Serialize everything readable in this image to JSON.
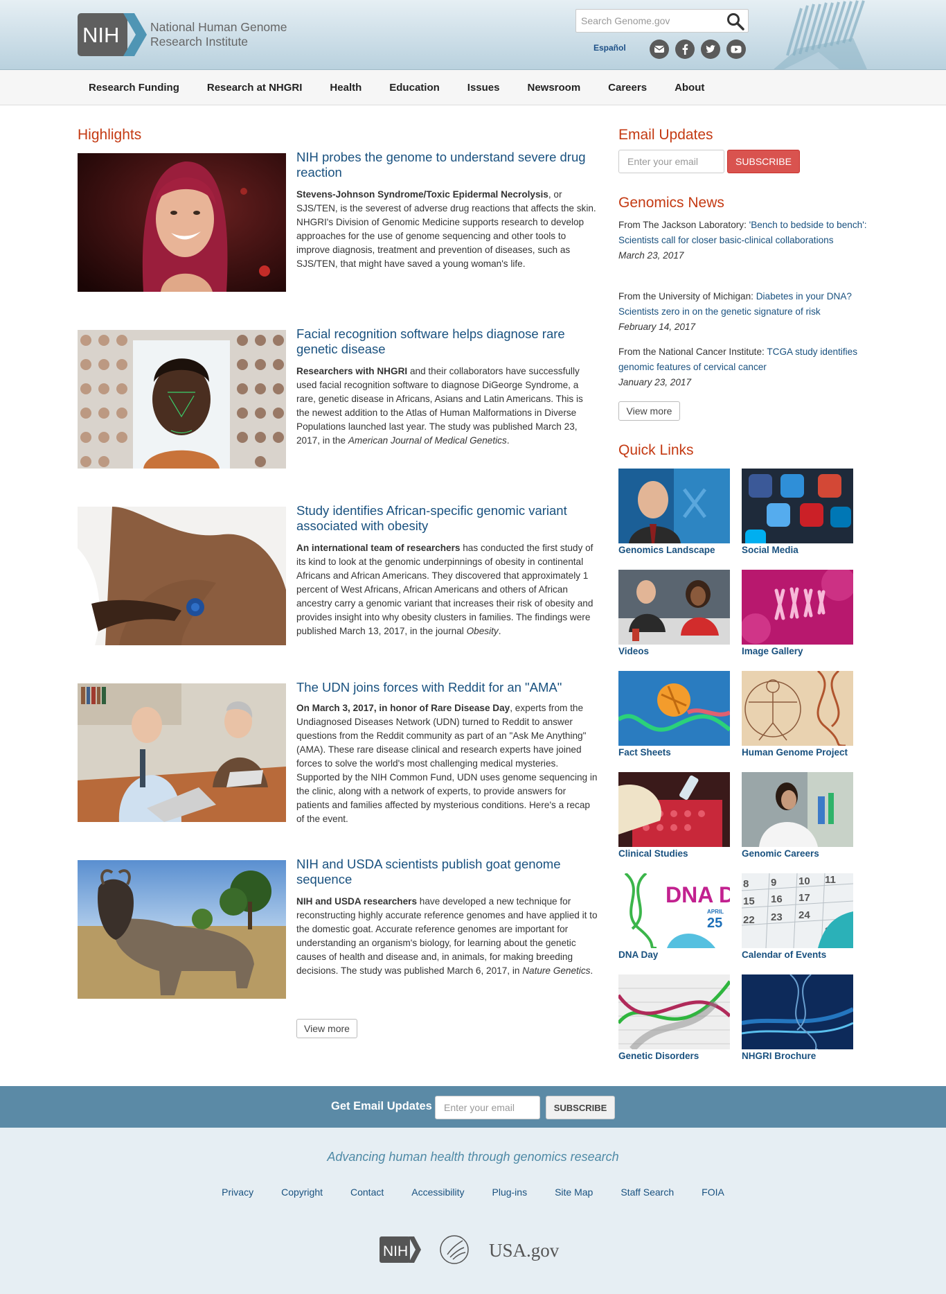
{
  "header": {
    "logo_text": "NIH",
    "org_name_line1": "National Human Genome",
    "org_name_line2": "Research Institute",
    "search_placeholder": "Search Genome.gov",
    "espanol": "Español",
    "social_icons": [
      "email-icon",
      "facebook-icon",
      "twitter-icon",
      "youtube-icon"
    ]
  },
  "nav": {
    "items": [
      "Research Funding",
      "Research at NHGRI",
      "Health",
      "Education",
      "Issues",
      "Newsroom",
      "Careers",
      "About"
    ]
  },
  "highlights": {
    "heading": "Highlights",
    "articles": [
      {
        "title": "NIH probes the genome to understand severe drug reaction",
        "lead": "Stevens-Johnson Syndrome/Toxic Epidermal Necrolysis",
        "body": ", or SJS/TEN, is the severest of adverse drug reactions that affects the skin. NHGRI's Division of Genomic Medicine supports research to develop approaches for the use of genome sequencing and other tools to improve diagnosis, treatment and prevention of diseases, such as SJS/TEN, that might have saved a young woman's life."
      },
      {
        "title": "Facial recognition software helps diagnose rare genetic disease",
        "lead": "Researchers with NHGRI",
        "body": " and their collaborators have successfully used facial recognition software to diagnose DiGeorge Syndrome, a rare, genetic disease in Africans, Asians and Latin Americans. This is the newest addition to the Atlas of Human Malformations in Diverse Populations launched last year. The study was published March 23, 2017, in the ",
        "journal": "American Journal of Medical Genetics",
        "tail": "."
      },
      {
        "title": "Study identifies African-specific genomic variant associated with obesity",
        "lead": "An international team of researchers",
        "body": " has conducted the first study of its kind to look at the genomic underpinnings of obesity in continental Africans and African Americans. They discovered that approximately 1 percent of West Africans, African Americans and others of African ancestry carry a genomic variant that increases their risk of obesity and provides insight into why obesity clusters in families. The findings were published March 13, 2017, in the journal ",
        "journal": "Obesity",
        "tail": "."
      },
      {
        "title": "The UDN joins forces with Reddit for an \"AMA\"",
        "lead": "On March 3, 2017, in honor of Rare Disease Day",
        "body": ", experts from the Undiagnosed Diseases Network (UDN) turned to Reddit to answer questions from the Reddit community as part of an \"Ask Me Anything\" (AMA). These rare disease clinical and research experts have joined forces to solve the world's most challenging medical mysteries. Supported by the NIH Common Fund, UDN uses genome sequencing in the clinic, along with a network of experts, to provide answers for patients and families affected by mysterious conditions. Here's a recap of the event."
      },
      {
        "title": "NIH and USDA scientists publish goat genome sequence",
        "lead": "NIH and USDA researchers",
        "body": " have developed a new technique for reconstructing highly accurate reference genomes and have applied it to the domestic goat. Accurate reference genomes are important for understanding an organism's biology, for learning about the genetic causes of health and disease and, in animals, for making breeding decisions. The study was published March 6, 2017, in ",
        "journal": "Nature Genetics",
        "tail": "."
      }
    ],
    "view_more": "View more"
  },
  "sidebar": {
    "email_heading": "Email Updates",
    "email_placeholder": "Enter your email",
    "subscribe": "SUBSCRIBE",
    "news_heading": "Genomics News",
    "news": [
      {
        "source": "From The Jackson Laboratory: ",
        "link": "'Bench to bedside to bench': Scientists call for closer basic-clinical collaborations",
        "date": "March 23, 2017"
      },
      {
        "source": "From the University of Michigan: ",
        "link": "Diabetes in your DNA? Scientists zero in on the genetic signature of risk",
        "date": "February 14, 2017"
      },
      {
        "source": "From the National Cancer Institute: ",
        "link": "TCGA study identifies genomic features of cervical cancer",
        "date": "January 23, 2017"
      }
    ],
    "news_view_more": "View more",
    "quick_heading": "Quick Links",
    "quick_links": [
      "Genomics Landscape",
      "Social Media",
      "Videos",
      "Image Gallery",
      "Fact Sheets",
      "Human Genome Project",
      "Clinical Studies",
      "Genomic Careers",
      "DNA Day",
      "Calendar of Events",
      "Genetic Disorders",
      "NHGRI Brochure"
    ],
    "dna_day_text": "DNA DAY",
    "dna_day_month": "APRIL",
    "dna_day_date": "25"
  },
  "footer": {
    "band_label": "Get Email Updates",
    "band_placeholder": "Enter your email",
    "band_subscribe": "SUBSCRIBE",
    "tagline": "Advancing human health through genomics research",
    "links": [
      "Privacy",
      "Copyright",
      "Contact",
      "Accessibility",
      "Plug-ins",
      "Site Map",
      "Staff Search",
      "FOIA"
    ],
    "nih_logo_text": "NIH",
    "usagov_text": "USA.gov"
  },
  "colors": {
    "accent_red": "#c43a13",
    "link_blue": "#19517f",
    "band_blue": "#5b8aa6",
    "subscribe_red": "#d9534f"
  }
}
